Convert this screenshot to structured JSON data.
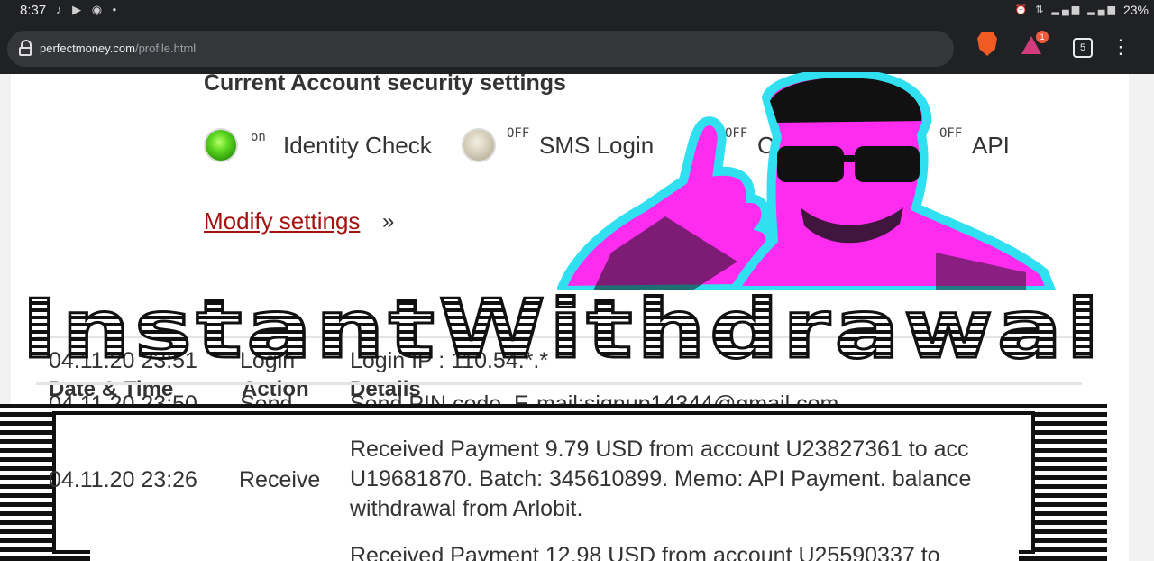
{
  "status_bar": {
    "time": "8:37",
    "notifications": "♪ ▶ ◉ •",
    "system": "⏰ ⇅ ▂▄▆ ▂▄▆",
    "battery": "23%"
  },
  "browser": {
    "url_host": "perfectmoney.com",
    "url_path": "/profile.html",
    "tab_count": "5",
    "rewards_badge": "1"
  },
  "security": {
    "title": "Current Account security settings",
    "items": [
      {
        "state": "on",
        "label": "Identity Check",
        "active": true
      },
      {
        "state": "OFF",
        "label": "SMS Login",
        "active": false
      },
      {
        "state": "OFF",
        "label": "Co",
        "active": false
      },
      {
        "state": "OFF",
        "label": "API",
        "active": false
      }
    ],
    "modify_link": "Modify settings",
    "modify_suffix": "»"
  },
  "banner_text": "InstantWithdrawal",
  "log": {
    "columns": [
      "Date & Time",
      "Action",
      "Details"
    ],
    "rows": [
      {
        "date": "04.11.20 23:51",
        "action": "Login",
        "details": "Login IP : 110.54.*.*"
      },
      {
        "date": "04.11.20 23:50",
        "action": "Send",
        "details": "Send PIN code. E-mail:signup14344@gmail.com"
      },
      {
        "date": "04.11.20 23:26",
        "action": "Receive",
        "details": [
          "Received Payment 9.79 USD from account U23827361 to acc",
          "U19681870. Batch: 345610899. Memo: API Payment. balance",
          "withdrawal from Arlobit."
        ]
      },
      {
        "date": "",
        "action": "",
        "details": "Received Payment 12.98 USD from account U25590337 to"
      }
    ]
  }
}
